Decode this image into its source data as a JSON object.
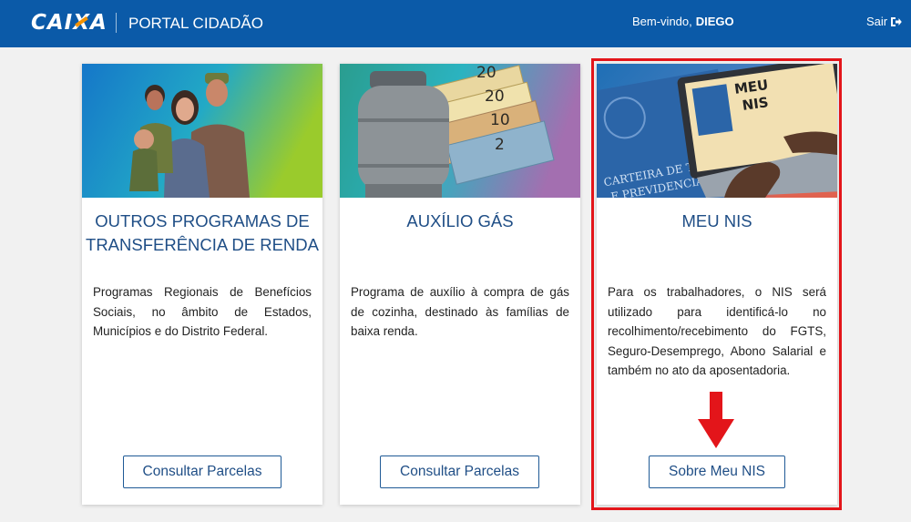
{
  "header": {
    "logo": "CAIXA",
    "portal_title": "PORTAL CIDADÃO",
    "welcome_label": "Bem-vindo,",
    "user_name": "DIEGO",
    "logout_label": "Sair"
  },
  "cards": [
    {
      "title": "OUTROS PROGRAMAS DE TRANSFERÊNCIA DE RENDA",
      "description": "Programas Regionais de Benefícios Sociais, no âmbito de Estados, Municípios e do Distrito Federal.",
      "button": "Consultar Parcelas"
    },
    {
      "title": "AUXÍLIO GÁS",
      "description": "Programa de auxílio à compra de gás de cozinha, destinado às famílias de baixa renda.",
      "button": "Consultar Parcelas"
    },
    {
      "title": "MEU NIS",
      "description": "Para os trabalhadores, o NIS será utilizado para identificá-lo no recolhimento/recebimento do FGTS, Seguro-Desemprego, Abono Salarial e também no ato da aposentadoria.",
      "button": "Sobre Meu NIS",
      "image_text": {
        "screen": "MEU NIS",
        "card_line1": "CARTEIRA DE TRAB",
        "card_line2": "E PREVIDENCIA SOCIAL"
      }
    }
  ],
  "gas_bills": [
    "20",
    "20",
    "10",
    "2"
  ],
  "colors": {
    "header_bg": "#0b5aa8",
    "title_text": "#1f4e86",
    "highlight": "#e3151a",
    "logo_accent": "#f39200"
  }
}
